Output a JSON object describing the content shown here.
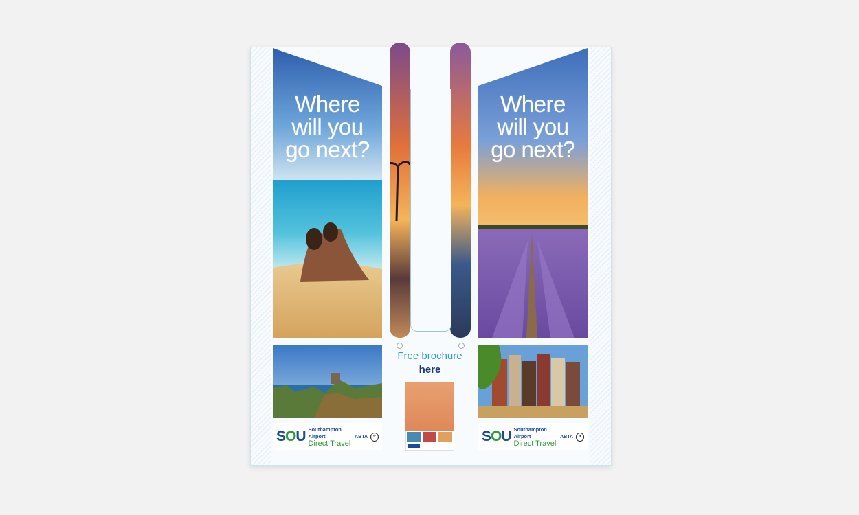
{
  "left_panel": {
    "headline": [
      "Where",
      "will you",
      "go next?"
    ],
    "logo": {
      "code_a": "S",
      "code_b": "O",
      "code_c": "U",
      "line1": "Southampton Airport",
      "line2": "Direct Travel",
      "abta": "ABTA"
    }
  },
  "right_panel": {
    "headline": [
      "Where",
      "will you",
      "go next?"
    ],
    "logo": {
      "code_a": "S",
      "code_b": "O",
      "code_c": "U",
      "line1": "Southampton Airport",
      "line2": "Direct Travel",
      "abta": "ABTA"
    }
  },
  "center_panel": {
    "title": "Free brochure",
    "subtitle": "here"
  },
  "colors": {
    "brand_blue": "#1a4a9a",
    "brand_green": "#2f9a3a",
    "accent_cyan": "#2f9fc7"
  }
}
